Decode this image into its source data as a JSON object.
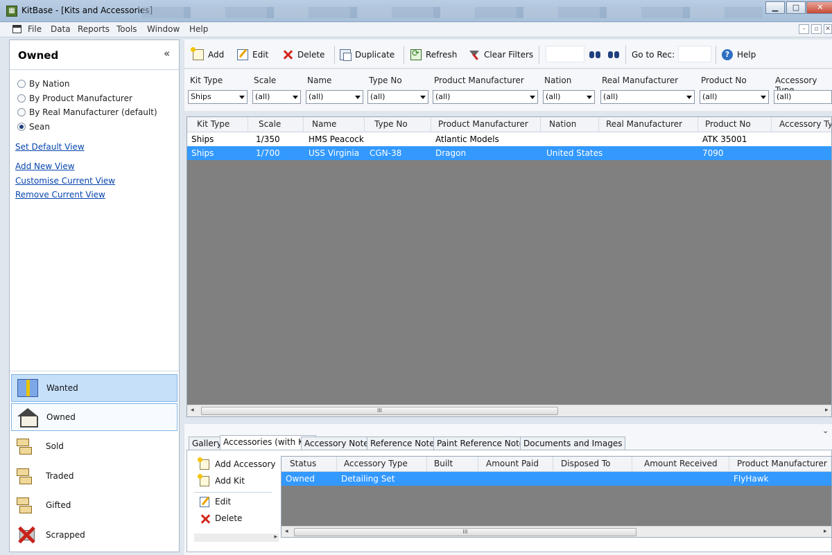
{
  "window": {
    "title": "KitBase - [Kits and Accessories]",
    "min_glyph": "▁",
    "max_glyph": "□",
    "close_glyph": "✕"
  },
  "menu": [
    "File",
    "Data",
    "Reports",
    "Tools",
    "Window",
    "Help"
  ],
  "mdi": {
    "min_glyph": "–",
    "restore_glyph": "▫",
    "close_glyph": "✕"
  },
  "left_panel": {
    "title": "Owned",
    "collapse_glyph": "«",
    "views": [
      {
        "label": "By Nation",
        "selected": false
      },
      {
        "label": "By Product Manufacturer",
        "selected": false
      },
      {
        "label": "By Real Manufacturer (default)",
        "selected": false
      },
      {
        "label": "Sean",
        "selected": true
      }
    ],
    "links": {
      "set_default": "Set Default View",
      "add_new": "Add New View",
      "customise": "Customise Current View",
      "remove": "Remove Current View"
    },
    "nav": [
      {
        "label": "Wanted",
        "icon": "gift-icon"
      },
      {
        "label": "Owned",
        "icon": "house-icon"
      },
      {
        "label": "Sold",
        "icon": "sold-icon"
      },
      {
        "label": "Traded",
        "icon": "traded-icon"
      },
      {
        "label": "Gifted",
        "icon": "gifted-icon"
      },
      {
        "label": "Scrapped",
        "icon": "scrapped-icon"
      }
    ]
  },
  "toolbar": {
    "add": "Add",
    "edit": "Edit",
    "delete": "Delete",
    "duplicate": "Duplicate",
    "refresh": "Refresh",
    "clear_filters": "Clear Filters",
    "go_to_rec": "Go to Rec:",
    "help": "Help"
  },
  "filters": [
    {
      "label": "Kit Type",
      "value": "Ships"
    },
    {
      "label": "Scale",
      "value": "(all)"
    },
    {
      "label": "Name",
      "value": "(all)"
    },
    {
      "label": "Type No",
      "value": "(all)"
    },
    {
      "label": "Product Manufacturer",
      "value": "(all)"
    },
    {
      "label": "Nation",
      "value": "(all)"
    },
    {
      "label": "Real Manufacturer",
      "value": "(all)"
    },
    {
      "label": "Product No",
      "value": "(all)"
    },
    {
      "label": "Accessory Type",
      "value": "(all)"
    }
  ],
  "kits_grid": {
    "columns": [
      "Kit Type",
      "Scale",
      "Name",
      "Type No",
      "Product Manufacturer",
      "Nation",
      "Real Manufacturer",
      "Product No",
      "Accessory Type"
    ],
    "rows": [
      [
        "Ships",
        "1/350",
        "HMS Peacock",
        "",
        "Atlantic Models",
        "",
        "",
        "ATK 35001",
        ""
      ],
      [
        "Ships",
        "1/700",
        "USS Virginia",
        "CGN-38",
        "Dragon",
        "United States",
        "",
        "7090",
        ""
      ]
    ],
    "selected_row": 1,
    "scroll_thumb": "III"
  },
  "bottom": {
    "expander_glyph": "⌄",
    "tabs": [
      "Gallery",
      "Accessories (with Kit)",
      "Accessory Notes",
      "Reference Notes",
      "Paint Reference Notes",
      "Documents and Images"
    ],
    "active_tab": 1,
    "actions": {
      "add_accessory": "Add Accessory",
      "add_kit": "Add Kit",
      "edit": "Edit",
      "delete": "Delete"
    },
    "grid": {
      "columns": [
        "Status",
        "Accessory Type",
        "Built",
        "Amount Paid",
        "Disposed To",
        "Amount Received",
        "Product Manufacturer"
      ],
      "rows": [
        [
          "Owned",
          "Detailing Set",
          "",
          "",
          "",
          "",
          "FlyHawk"
        ]
      ],
      "selected_row": 0,
      "scroll_thumb": "III"
    }
  }
}
